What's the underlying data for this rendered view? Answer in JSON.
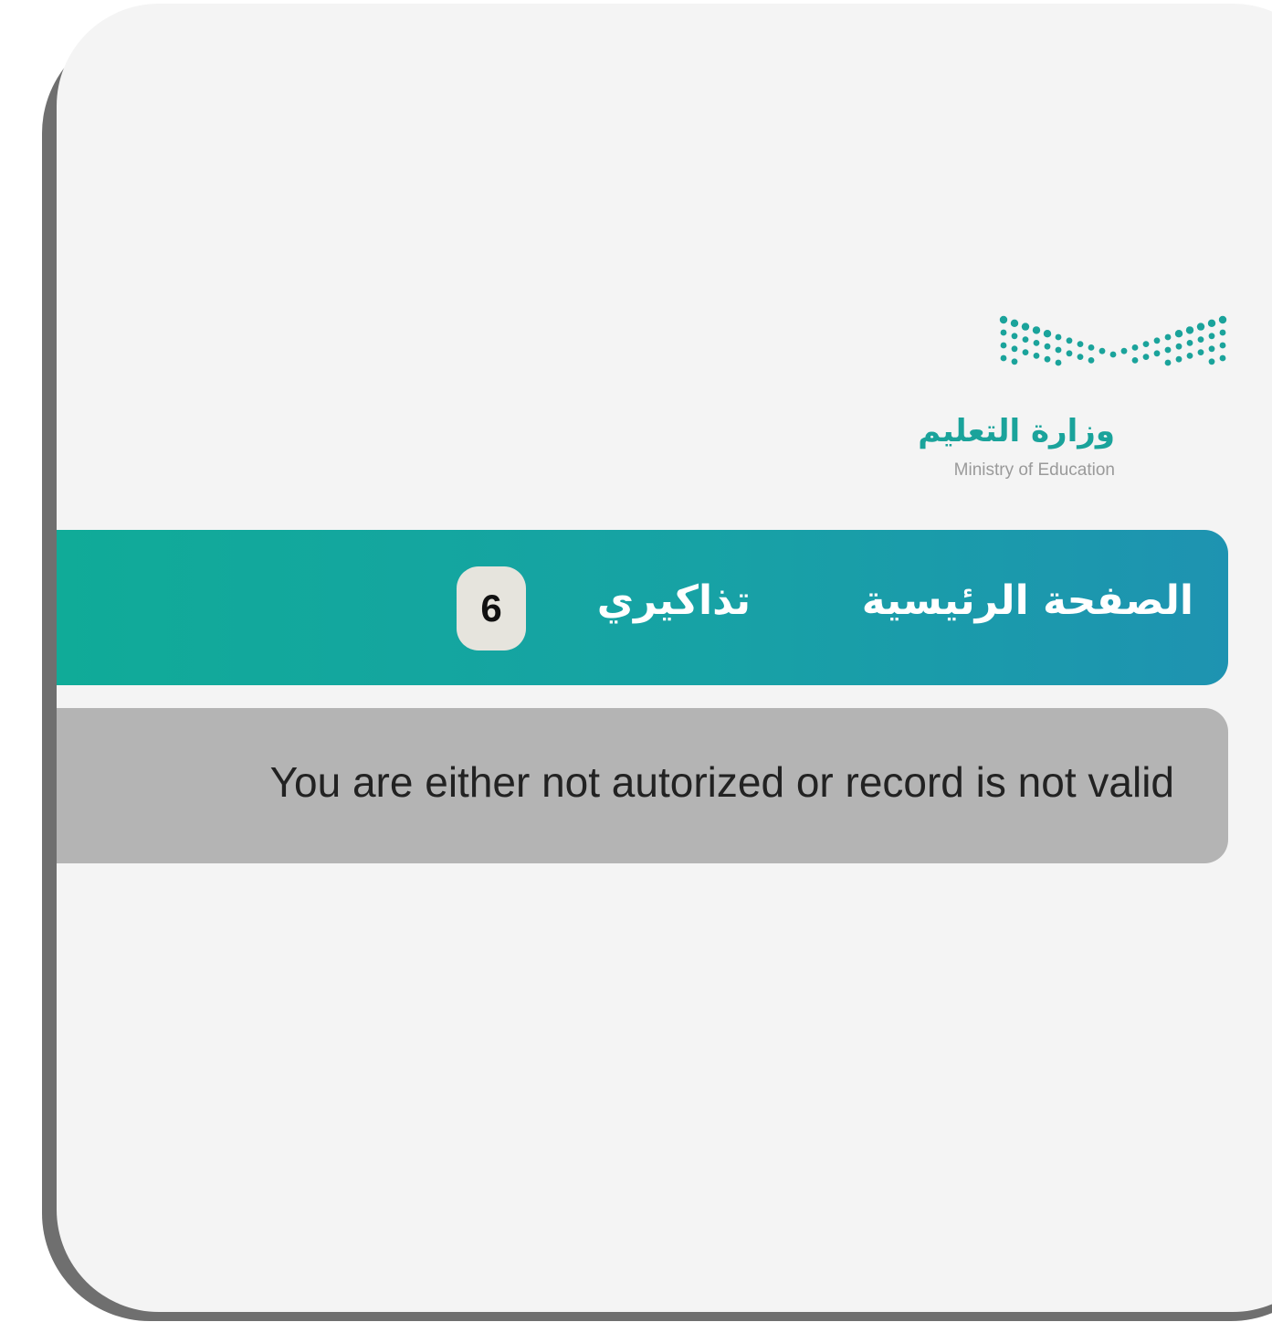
{
  "logo": {
    "arabic_name": "وزارة التعليم",
    "english_name": "Ministry of Education",
    "icon": "ministry-logo-dots-icon",
    "color": "#1aa39b"
  },
  "nav": {
    "home_label": "الصفحة الرئيسية",
    "tickets_label": "تذاكيري",
    "tickets_count": "6",
    "gradient": [
      "#10ab98",
      "#1e93b1"
    ]
  },
  "alert": {
    "message": "You are either not autorized or record is not valid",
    "background": "#b4b4b4"
  }
}
